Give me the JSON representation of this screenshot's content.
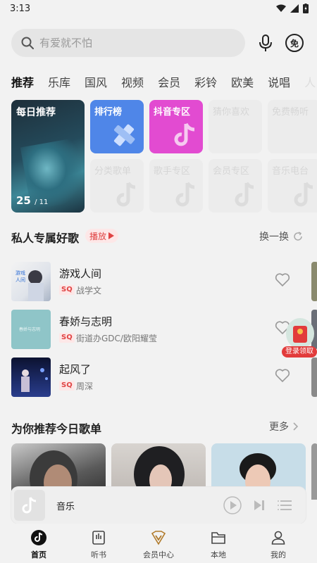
{
  "status": {
    "time": "3:13"
  },
  "search": {
    "placeholder": "有爱就不怕"
  },
  "header": {
    "free_label": "免"
  },
  "tabs": [
    "推荐",
    "乐库",
    "国风",
    "视频",
    "会员",
    "彩铃",
    "欧美",
    "说唱",
    "人"
  ],
  "grid": {
    "daily": {
      "label": "每日推荐",
      "day": "25",
      "month": "/ 11"
    },
    "tiles": [
      {
        "label": "排行榜",
        "color": "#4f86e8"
      },
      {
        "label": "抖音专区",
        "color": "#e24bd1"
      },
      {
        "label": "猜你喜欢"
      },
      {
        "label": "免费畅听"
      },
      {
        "label": "分类歌单"
      },
      {
        "label": "歌手专区"
      },
      {
        "label": "会员专区"
      },
      {
        "label": "音乐电台"
      }
    ]
  },
  "private": {
    "title": "私人专属好歌",
    "play_label": "播放",
    "refresh_label": "换一换",
    "songs": [
      {
        "name": "游戏人间",
        "badge": "SQ",
        "artist": "战学文"
      },
      {
        "name": "春娇与志明",
        "badge": "SQ",
        "artist": "街道办GDC/欧阳耀莹"
      },
      {
        "name": "起风了",
        "badge": "SQ",
        "artist": "周深"
      }
    ]
  },
  "gift": {
    "label": "登录领取"
  },
  "playlists": {
    "title": "为你推荐今日歌单",
    "more_label": "更多"
  },
  "player": {
    "title": "音乐"
  },
  "nav": [
    {
      "label": "首页",
      "icon": "home-disc-icon"
    },
    {
      "label": "听书",
      "icon": "book-icon"
    },
    {
      "label": "会员中心",
      "icon": "vip-icon"
    },
    {
      "label": "本地",
      "icon": "folder-icon"
    },
    {
      "label": "我的",
      "icon": "user-icon"
    }
  ],
  "colors": {
    "accent": "#e04444",
    "text": "#222222",
    "background": "#f2f2f2"
  }
}
